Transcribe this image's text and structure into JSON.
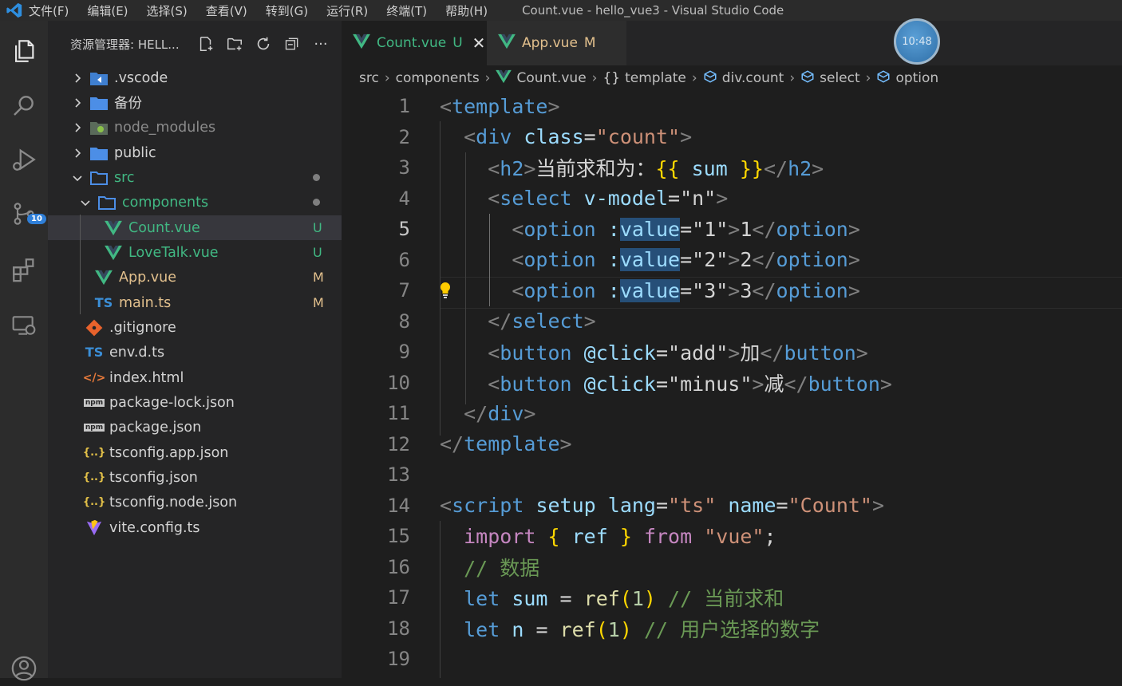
{
  "titlebar": {
    "menu": [
      "文件(F)",
      "编辑(E)",
      "选择(S)",
      "查看(V)",
      "转到(G)",
      "运行(R)",
      "终端(T)",
      "帮助(H)"
    ],
    "window_title": "Count.vue - hello_vue3 - Visual Studio Code"
  },
  "activitybar": {
    "items": [
      "explorer-icon",
      "search-icon",
      "run-debug-icon",
      "source-control-icon",
      "extensions-icon",
      "remote-explorer-icon",
      "account-icon"
    ],
    "source_control_badge": "10"
  },
  "sidebar": {
    "title": "资源管理器: HELL...",
    "actions": [
      "new-file-icon",
      "new-folder-icon",
      "refresh-icon",
      "collapse-all-icon",
      "more-icon"
    ],
    "tree": [
      {
        "label": ".vscode",
        "icon": "vscode-folder-icon",
        "status": ""
      },
      {
        "label": "备份",
        "icon": "folder-icon",
        "status": ""
      },
      {
        "label": "node_modules",
        "icon": "node-folder-icon",
        "status": ""
      },
      {
        "label": "public",
        "icon": "folder-icon",
        "status": ""
      },
      {
        "label": "src",
        "icon": "folder-open-icon",
        "status": ""
      },
      {
        "label": "components",
        "icon": "folder-open-icon",
        "status": ""
      },
      {
        "label": "Count.vue",
        "icon": "vue-icon",
        "status": "U"
      },
      {
        "label": "LoveTalk.vue",
        "icon": "vue-icon",
        "status": "U"
      },
      {
        "label": "App.vue",
        "icon": "vue-icon",
        "status": "M"
      },
      {
        "label": "main.ts",
        "icon": "ts-icon",
        "status": "M",
        "icon_text": "TS"
      },
      {
        "label": ".gitignore",
        "icon": "git-icon",
        "status": ""
      },
      {
        "label": "env.d.ts",
        "icon": "ts-icon",
        "status": "",
        "icon_text": "TS"
      },
      {
        "label": "index.html",
        "icon": "html-icon",
        "status": "",
        "icon_text": "</>"
      },
      {
        "label": "package-lock.json",
        "icon": "npm-icon",
        "status": "",
        "icon_text": "npm"
      },
      {
        "label": "package.json",
        "icon": "npm-icon",
        "status": "",
        "icon_text": "npm"
      },
      {
        "label": "tsconfig.app.json",
        "icon": "json-icon",
        "status": "",
        "icon_text": "{..}"
      },
      {
        "label": "tsconfig.json",
        "icon": "json-icon",
        "status": "",
        "icon_text": "{..}"
      },
      {
        "label": "tsconfig.node.json",
        "icon": "json-icon",
        "status": "",
        "icon_text": "{..}"
      },
      {
        "label": "vite.config.ts",
        "icon": "vite-icon",
        "status": ""
      }
    ]
  },
  "tabs": [
    {
      "label": "Count.vue",
      "status": "U",
      "active": true
    },
    {
      "label": "App.vue",
      "status": "M",
      "active": false
    }
  ],
  "breadcrumb": [
    "src",
    "components",
    "Count.vue",
    "template",
    "div.count",
    "select",
    "option"
  ],
  "clock": "10:48",
  "editor": {
    "line_numbers": [
      "1",
      "2",
      "3",
      "4",
      "5",
      "6",
      "7",
      "8",
      "9",
      "10",
      "11",
      "12",
      "13",
      "14",
      "15",
      "16",
      "17",
      "18",
      "19"
    ],
    "active_line": "5",
    "lines": [
      [
        {
          "t": "<",
          "c": "br"
        },
        {
          "t": "template",
          "c": "tag"
        },
        {
          "t": ">",
          "c": "br"
        }
      ],
      [
        {
          "t": "  "
        },
        {
          "t": "<",
          "c": "br"
        },
        {
          "t": "div",
          "c": "tag"
        },
        {
          "t": " "
        },
        {
          "t": "class",
          "c": "attr"
        },
        {
          "t": "=",
          "c": "txt"
        },
        {
          "t": "\"count\"",
          "c": "str"
        },
        {
          "t": ">",
          "c": "br"
        }
      ],
      [
        {
          "t": "    "
        },
        {
          "t": "<",
          "c": "br"
        },
        {
          "t": "h2",
          "c": "tag"
        },
        {
          "t": ">",
          "c": "br"
        },
        {
          "t": "当前求和为：",
          "c": "txt"
        },
        {
          "t": "{{",
          "c": "brc"
        },
        {
          "t": " sum ",
          "c": "var"
        },
        {
          "t": "}}",
          "c": "brc"
        },
        {
          "t": "</",
          "c": "br"
        },
        {
          "t": "h2",
          "c": "tag"
        },
        {
          "t": ">",
          "c": "br"
        }
      ],
      [
        {
          "t": "    "
        },
        {
          "t": "<",
          "c": "br"
        },
        {
          "t": "select",
          "c": "tag"
        },
        {
          "t": " "
        },
        {
          "t": "v-model",
          "c": "attr"
        },
        {
          "t": "=",
          "c": "txt"
        },
        {
          "t": "\"n\"",
          "c": "txt"
        },
        {
          "t": ">",
          "c": "br"
        }
      ],
      [
        {
          "t": "      "
        },
        {
          "t": "<",
          "c": "br"
        },
        {
          "t": "option",
          "c": "tag"
        },
        {
          "t": " "
        },
        {
          "t": ":",
          "c": "attr"
        },
        {
          "t": "value",
          "c": "attr hl"
        },
        {
          "t": "=",
          "c": "txt"
        },
        {
          "t": "\"1\"",
          "c": "txt"
        },
        {
          "t": ">",
          "c": "br"
        },
        {
          "t": "1",
          "c": "txt"
        },
        {
          "t": "</",
          "c": "br"
        },
        {
          "t": "option",
          "c": "tag"
        },
        {
          "t": ">",
          "c": "br"
        }
      ],
      [
        {
          "t": "      "
        },
        {
          "t": "<",
          "c": "br"
        },
        {
          "t": "option",
          "c": "tag"
        },
        {
          "t": " "
        },
        {
          "t": ":",
          "c": "attr"
        },
        {
          "t": "value",
          "c": "attr hl"
        },
        {
          "t": "=",
          "c": "txt"
        },
        {
          "t": "\"2\"",
          "c": "txt"
        },
        {
          "t": ">",
          "c": "br"
        },
        {
          "t": "2",
          "c": "txt"
        },
        {
          "t": "</",
          "c": "br"
        },
        {
          "t": "option",
          "c": "tag"
        },
        {
          "t": ">",
          "c": "br"
        }
      ],
      [
        {
          "t": "      "
        },
        {
          "t": "<",
          "c": "br"
        },
        {
          "t": "option",
          "c": "tag"
        },
        {
          "t": " "
        },
        {
          "t": ":",
          "c": "attr"
        },
        {
          "t": "value",
          "c": "attr hl"
        },
        {
          "t": "=",
          "c": "txt"
        },
        {
          "t": "\"3\"",
          "c": "txt"
        },
        {
          "t": ">",
          "c": "br"
        },
        {
          "t": "3",
          "c": "txt"
        },
        {
          "t": "</",
          "c": "br"
        },
        {
          "t": "option",
          "c": "tag"
        },
        {
          "t": ">",
          "c": "br"
        }
      ],
      [
        {
          "t": "    "
        },
        {
          "t": "</",
          "c": "br"
        },
        {
          "t": "select",
          "c": "tag"
        },
        {
          "t": ">",
          "c": "br"
        }
      ],
      [
        {
          "t": "    "
        },
        {
          "t": "<",
          "c": "br"
        },
        {
          "t": "button",
          "c": "tag"
        },
        {
          "t": " "
        },
        {
          "t": "@click",
          "c": "attr"
        },
        {
          "t": "=",
          "c": "txt"
        },
        {
          "t": "\"add\"",
          "c": "txt"
        },
        {
          "t": ">",
          "c": "br"
        },
        {
          "t": "加",
          "c": "txt"
        },
        {
          "t": "</",
          "c": "br"
        },
        {
          "t": "button",
          "c": "tag"
        },
        {
          "t": ">",
          "c": "br"
        }
      ],
      [
        {
          "t": "    "
        },
        {
          "t": "<",
          "c": "br"
        },
        {
          "t": "button",
          "c": "tag"
        },
        {
          "t": " "
        },
        {
          "t": "@click",
          "c": "attr"
        },
        {
          "t": "=",
          "c": "txt"
        },
        {
          "t": "\"minus\"",
          "c": "txt"
        },
        {
          "t": ">",
          "c": "br"
        },
        {
          "t": "减",
          "c": "txt"
        },
        {
          "t": "</",
          "c": "br"
        },
        {
          "t": "button",
          "c": "tag"
        },
        {
          "t": ">",
          "c": "br"
        }
      ],
      [
        {
          "t": "  "
        },
        {
          "t": "</",
          "c": "br"
        },
        {
          "t": "div",
          "c": "tag"
        },
        {
          "t": ">",
          "c": "br"
        }
      ],
      [
        {
          "t": "</",
          "c": "br"
        },
        {
          "t": "template",
          "c": "tag"
        },
        {
          "t": ">",
          "c": "br"
        }
      ],
      [],
      [
        {
          "t": "<",
          "c": "br"
        },
        {
          "t": "script",
          "c": "tag"
        },
        {
          "t": " "
        },
        {
          "t": "setup",
          "c": "attr"
        },
        {
          "t": " "
        },
        {
          "t": "lang",
          "c": "attr"
        },
        {
          "t": "=",
          "c": "txt"
        },
        {
          "t": "\"ts\"",
          "c": "str"
        },
        {
          "t": " "
        },
        {
          "t": "name",
          "c": "attr"
        },
        {
          "t": "=",
          "c": "txt"
        },
        {
          "t": "\"Count\"",
          "c": "str"
        },
        {
          "t": ">",
          "c": "br"
        }
      ],
      [
        {
          "t": "  "
        },
        {
          "t": "import",
          "c": "kw"
        },
        {
          "t": " "
        },
        {
          "t": "{",
          "c": "brc"
        },
        {
          "t": " ref ",
          "c": "var"
        },
        {
          "t": "}",
          "c": "brc"
        },
        {
          "t": " "
        },
        {
          "t": "from",
          "c": "kw"
        },
        {
          "t": " "
        },
        {
          "t": "\"vue\"",
          "c": "str"
        },
        {
          "t": ";",
          "c": "txt"
        }
      ],
      [
        {
          "t": "  "
        },
        {
          "t": "// 数据",
          "c": "cm"
        }
      ],
      [
        {
          "t": "  "
        },
        {
          "t": "let",
          "c": "kw2"
        },
        {
          "t": " "
        },
        {
          "t": "sum",
          "c": "var"
        },
        {
          "t": " = ",
          "c": "txt"
        },
        {
          "t": "ref",
          "c": "fn"
        },
        {
          "t": "(",
          "c": "brc"
        },
        {
          "t": "1",
          "c": "num"
        },
        {
          "t": ")",
          "c": "brc"
        },
        {
          "t": " "
        },
        {
          "t": "// 当前求和",
          "c": "cm"
        }
      ],
      [
        {
          "t": "  "
        },
        {
          "t": "let",
          "c": "kw2"
        },
        {
          "t": " "
        },
        {
          "t": "n",
          "c": "var"
        },
        {
          "t": " = ",
          "c": "txt"
        },
        {
          "t": "ref",
          "c": "fn"
        },
        {
          "t": "(",
          "c": "brc"
        },
        {
          "t": "1",
          "c": "num"
        },
        {
          "t": ")",
          "c": "brc"
        },
        {
          "t": " "
        },
        {
          "t": "// 用户选择的数字",
          "c": "cm"
        }
      ],
      []
    ]
  }
}
